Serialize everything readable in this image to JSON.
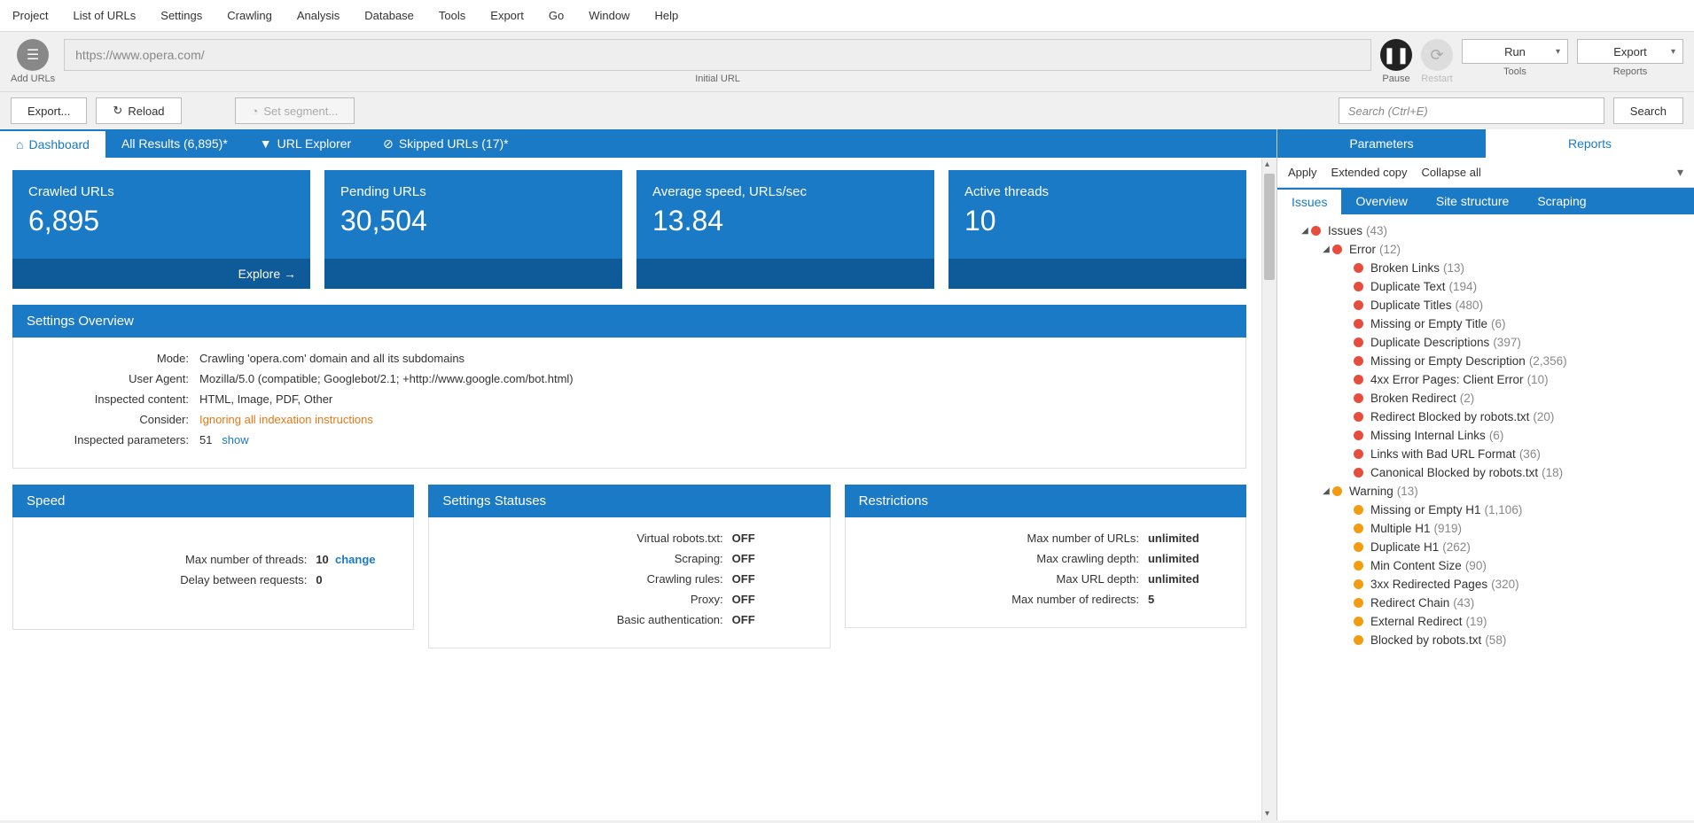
{
  "menubar": [
    "Project",
    "List of URLs",
    "Settings",
    "Crawling",
    "Analysis",
    "Database",
    "Tools",
    "Export",
    "Go",
    "Window",
    "Help"
  ],
  "topbar": {
    "add_urls": "Add URLs",
    "url": "https://www.opera.com/",
    "url_label": "Initial URL",
    "pause": "Pause",
    "restart": "Restart",
    "run": "Run",
    "tools": "Tools",
    "export": "Export",
    "reports": "Reports"
  },
  "secondbar": {
    "export": "Export...",
    "reload": "Reload",
    "set_segment": "Set segment...",
    "search_ph": "Search (Ctrl+E)",
    "search": "Search"
  },
  "main_tabs": {
    "dashboard": "Dashboard",
    "all_results": "All Results (6,895)*",
    "url_explorer": "URL Explorer",
    "skipped": "Skipped URLs (17)*"
  },
  "cards": [
    {
      "title": "Crawled URLs",
      "value": "6,895",
      "footer": "Explore →"
    },
    {
      "title": "Pending URLs",
      "value": "30,504",
      "footer": ""
    },
    {
      "title": "Average speed, URLs/sec",
      "value": "13.84",
      "footer": ""
    },
    {
      "title": "Active threads",
      "value": "10",
      "footer": ""
    }
  ],
  "settings_overview": {
    "title": "Settings Overview",
    "rows": [
      {
        "k": "Mode:",
        "v": "Crawling 'opera.com' domain and all its subdomains"
      },
      {
        "k": "User Agent:",
        "v": "Mozilla/5.0 (compatible; Googlebot/2.1; +http://www.google.com/bot.html)"
      },
      {
        "k": "Inspected content:",
        "v": "HTML, Image, PDF, Other"
      },
      {
        "k": "Consider:",
        "v": "Ignoring all indexation instructions",
        "orange": true
      },
      {
        "k": "Inspected parameters:",
        "v": "51",
        "link": "show"
      }
    ]
  },
  "speed": {
    "title": "Speed",
    "rows": [
      {
        "k": "Max number of threads:",
        "v": "10",
        "link": "change"
      },
      {
        "k": "Delay between requests:",
        "v": "0"
      }
    ]
  },
  "statuses": {
    "title": "Settings Statuses",
    "rows": [
      {
        "k": "Virtual robots.txt:",
        "v": "OFF"
      },
      {
        "k": "Scraping:",
        "v": "OFF"
      },
      {
        "k": "Crawling rules:",
        "v": "OFF"
      },
      {
        "k": "Proxy:",
        "v": "OFF"
      },
      {
        "k": "Basic authentication:",
        "v": "OFF"
      }
    ]
  },
  "restrictions": {
    "title": "Restrictions",
    "rows": [
      {
        "k": "Max number of URLs:",
        "v": "unlimited"
      },
      {
        "k": "Max crawling depth:",
        "v": "unlimited"
      },
      {
        "k": "Max URL depth:",
        "v": "unlimited"
      },
      {
        "k": "Max number of redirects:",
        "v": "5"
      }
    ]
  },
  "right": {
    "tabs": {
      "parameters": "Parameters",
      "reports": "Reports"
    },
    "toolbar": {
      "apply": "Apply",
      "extended": "Extended copy",
      "collapse": "Collapse all"
    },
    "subtabs": [
      "Issues",
      "Overview",
      "Site structure",
      "Scraping"
    ],
    "tree": {
      "root": {
        "label": "Issues",
        "count": "(43)"
      },
      "error": {
        "label": "Error",
        "count": "(12)"
      },
      "errors": [
        {
          "label": "Broken Links",
          "count": "(13)"
        },
        {
          "label": "Duplicate Text",
          "count": "(194)"
        },
        {
          "label": "Duplicate Titles",
          "count": "(480)"
        },
        {
          "label": "Missing or Empty Title",
          "count": "(6)"
        },
        {
          "label": "Duplicate Descriptions",
          "count": "(397)"
        },
        {
          "label": "Missing or Empty Description",
          "count": "(2,356)"
        },
        {
          "label": "4xx Error Pages: Client Error",
          "count": "(10)"
        },
        {
          "label": "Broken Redirect",
          "count": "(2)"
        },
        {
          "label": "Redirect Blocked by robots.txt",
          "count": "(20)"
        },
        {
          "label": "Missing Internal Links",
          "count": "(6)"
        },
        {
          "label": "Links with Bad URL Format",
          "count": "(36)"
        },
        {
          "label": "Canonical Blocked by robots.txt",
          "count": "(18)"
        }
      ],
      "warning": {
        "label": "Warning",
        "count": "(13)"
      },
      "warnings": [
        {
          "label": "Missing or Empty H1",
          "count": "(1,106)"
        },
        {
          "label": "Multiple H1",
          "count": "(919)"
        },
        {
          "label": "Duplicate H1",
          "count": "(262)"
        },
        {
          "label": "Min Content Size",
          "count": "(90)"
        },
        {
          "label": "3xx Redirected Pages",
          "count": "(320)"
        },
        {
          "label": "Redirect Chain",
          "count": "(43)"
        },
        {
          "label": "External Redirect",
          "count": "(19)"
        },
        {
          "label": "Blocked by robots.txt",
          "count": "(58)"
        }
      ]
    }
  }
}
